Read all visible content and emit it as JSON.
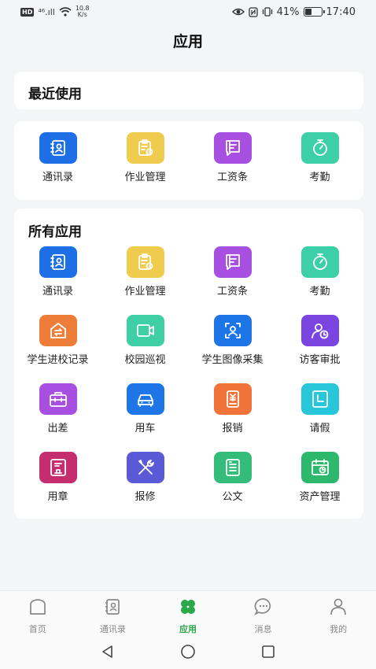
{
  "status_bar": {
    "hd": "HD",
    "signal": "⁴⁶.ıll",
    "speed_value": "10.8",
    "speed_unit": "K/s",
    "battery": "41%",
    "time": "17:40"
  },
  "page_title": "应用",
  "recent": {
    "title": "最近使用",
    "apps": [
      {
        "label": "通讯录",
        "icon": "contacts-icon",
        "color": "#1e6fe6"
      },
      {
        "label": "作业管理",
        "icon": "homework-icon",
        "color": "#f0cc4e"
      },
      {
        "label": "工资条",
        "icon": "payslip-icon",
        "color": "#a64fe0"
      },
      {
        "label": "考勤",
        "icon": "attendance-icon",
        "color": "#3dcfa7"
      }
    ]
  },
  "all": {
    "title": "所有应用",
    "apps": [
      {
        "label": "通讯录",
        "icon": "contacts-icon",
        "color": "#1e6fe6"
      },
      {
        "label": "作业管理",
        "icon": "homework-icon",
        "color": "#f0cc4e"
      },
      {
        "label": "工资条",
        "icon": "payslip-icon",
        "color": "#a64fe0"
      },
      {
        "label": "考勤",
        "icon": "attendance-icon",
        "color": "#3dcfa7"
      },
      {
        "label": "学生进校记录",
        "icon": "entry-record-icon",
        "color": "#ef7d3a"
      },
      {
        "label": "校园巡视",
        "icon": "campus-patrol-icon",
        "color": "#3fcfa6"
      },
      {
        "label": "学生图像采集",
        "icon": "image-capture-icon",
        "color": "#1e76e6"
      },
      {
        "label": "访客审批",
        "icon": "visitor-approval-icon",
        "color": "#7a45e0"
      },
      {
        "label": "出差",
        "icon": "business-trip-icon",
        "color": "#a64fe0"
      },
      {
        "label": "用车",
        "icon": "car-icon",
        "color": "#1e76e6"
      },
      {
        "label": "报销",
        "icon": "reimbursement-icon",
        "color": "#f0733a"
      },
      {
        "label": "请假",
        "icon": "leave-icon",
        "color": "#27c6d8"
      },
      {
        "label": "用章",
        "icon": "seal-icon",
        "color": "#c42e6e"
      },
      {
        "label": "报修",
        "icon": "repair-icon",
        "color": "#5a5ad6"
      },
      {
        "label": "公文",
        "icon": "document-icon",
        "color": "#34bd7a"
      },
      {
        "label": "资产管理",
        "icon": "asset-icon",
        "color": "#2eb86e"
      }
    ]
  },
  "tabs": [
    {
      "label": "首页",
      "icon": "home-icon",
      "active": false
    },
    {
      "label": "通讯录",
      "icon": "contacts-tab-icon",
      "active": false
    },
    {
      "label": "应用",
      "icon": "clover-icon",
      "active": true
    },
    {
      "label": "消息",
      "icon": "message-icon",
      "active": false
    },
    {
      "label": "我的",
      "icon": "profile-icon",
      "active": false
    }
  ],
  "colors": {
    "accent": "#2aa84a",
    "inactive_tab": "#888888"
  }
}
